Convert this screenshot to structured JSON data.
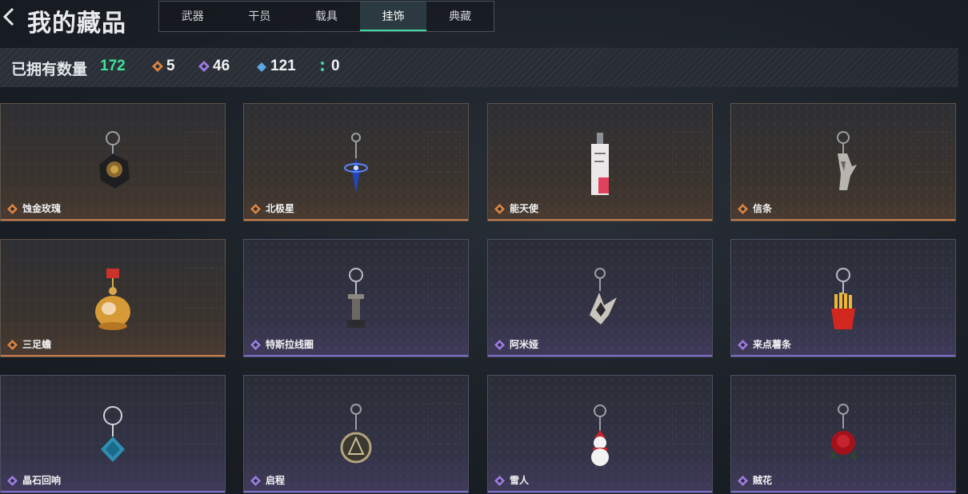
{
  "header": {
    "title": "我的藏品",
    "tabs": [
      {
        "label": "武器",
        "active": false
      },
      {
        "label": "干员",
        "active": false
      },
      {
        "label": "载具",
        "active": false
      },
      {
        "label": "挂饰",
        "active": true
      },
      {
        "label": "典藏",
        "active": false
      }
    ]
  },
  "stats": {
    "label": "已拥有数量",
    "total": "172",
    "counts": [
      {
        "icon": "orange-diamond-icon",
        "color": "#d9833f",
        "value": "5"
      },
      {
        "icon": "purple-diamond-icon",
        "color": "#9b7be0",
        "value": "46"
      },
      {
        "icon": "blue-diamond-icon",
        "color": "#5aa7e6",
        "value": "121"
      },
      {
        "icon": "green-dots-icon",
        "color": "#3fd7a0",
        "value": "0"
      }
    ]
  },
  "items": [
    {
      "name": "蚀金玫瑰",
      "rarity": "gold",
      "icon": "rose-charm-icon"
    },
    {
      "name": "北极星",
      "rarity": "gold",
      "icon": "star-charm-icon"
    },
    {
      "name": "能天使",
      "rarity": "gold",
      "icon": "card-charm-icon"
    },
    {
      "name": "信条",
      "rarity": "gold",
      "icon": "eagle-charm-icon"
    },
    {
      "name": "三足蟾",
      "rarity": "gold",
      "icon": "toad-charm-icon"
    },
    {
      "name": "特斯拉线圈",
      "rarity": "purple",
      "icon": "coil-charm-icon"
    },
    {
      "name": "阿米娅",
      "rarity": "purple",
      "icon": "ears-charm-icon"
    },
    {
      "name": "来点薯条",
      "rarity": "purple",
      "icon": "fries-charm-icon"
    },
    {
      "name": "晶石回响",
      "rarity": "purple",
      "icon": "crystal-charm-icon"
    },
    {
      "name": "启程",
      "rarity": "purple",
      "icon": "emblem-charm-icon"
    },
    {
      "name": "雪人",
      "rarity": "purple",
      "icon": "snowman-charm-icon"
    },
    {
      "name": "贼花",
      "rarity": "purple",
      "icon": "red-rose-charm-icon"
    }
  ],
  "colors": {
    "accent": "#3fe39a",
    "gold": "#d9833f",
    "purple": "#9b7be0"
  }
}
